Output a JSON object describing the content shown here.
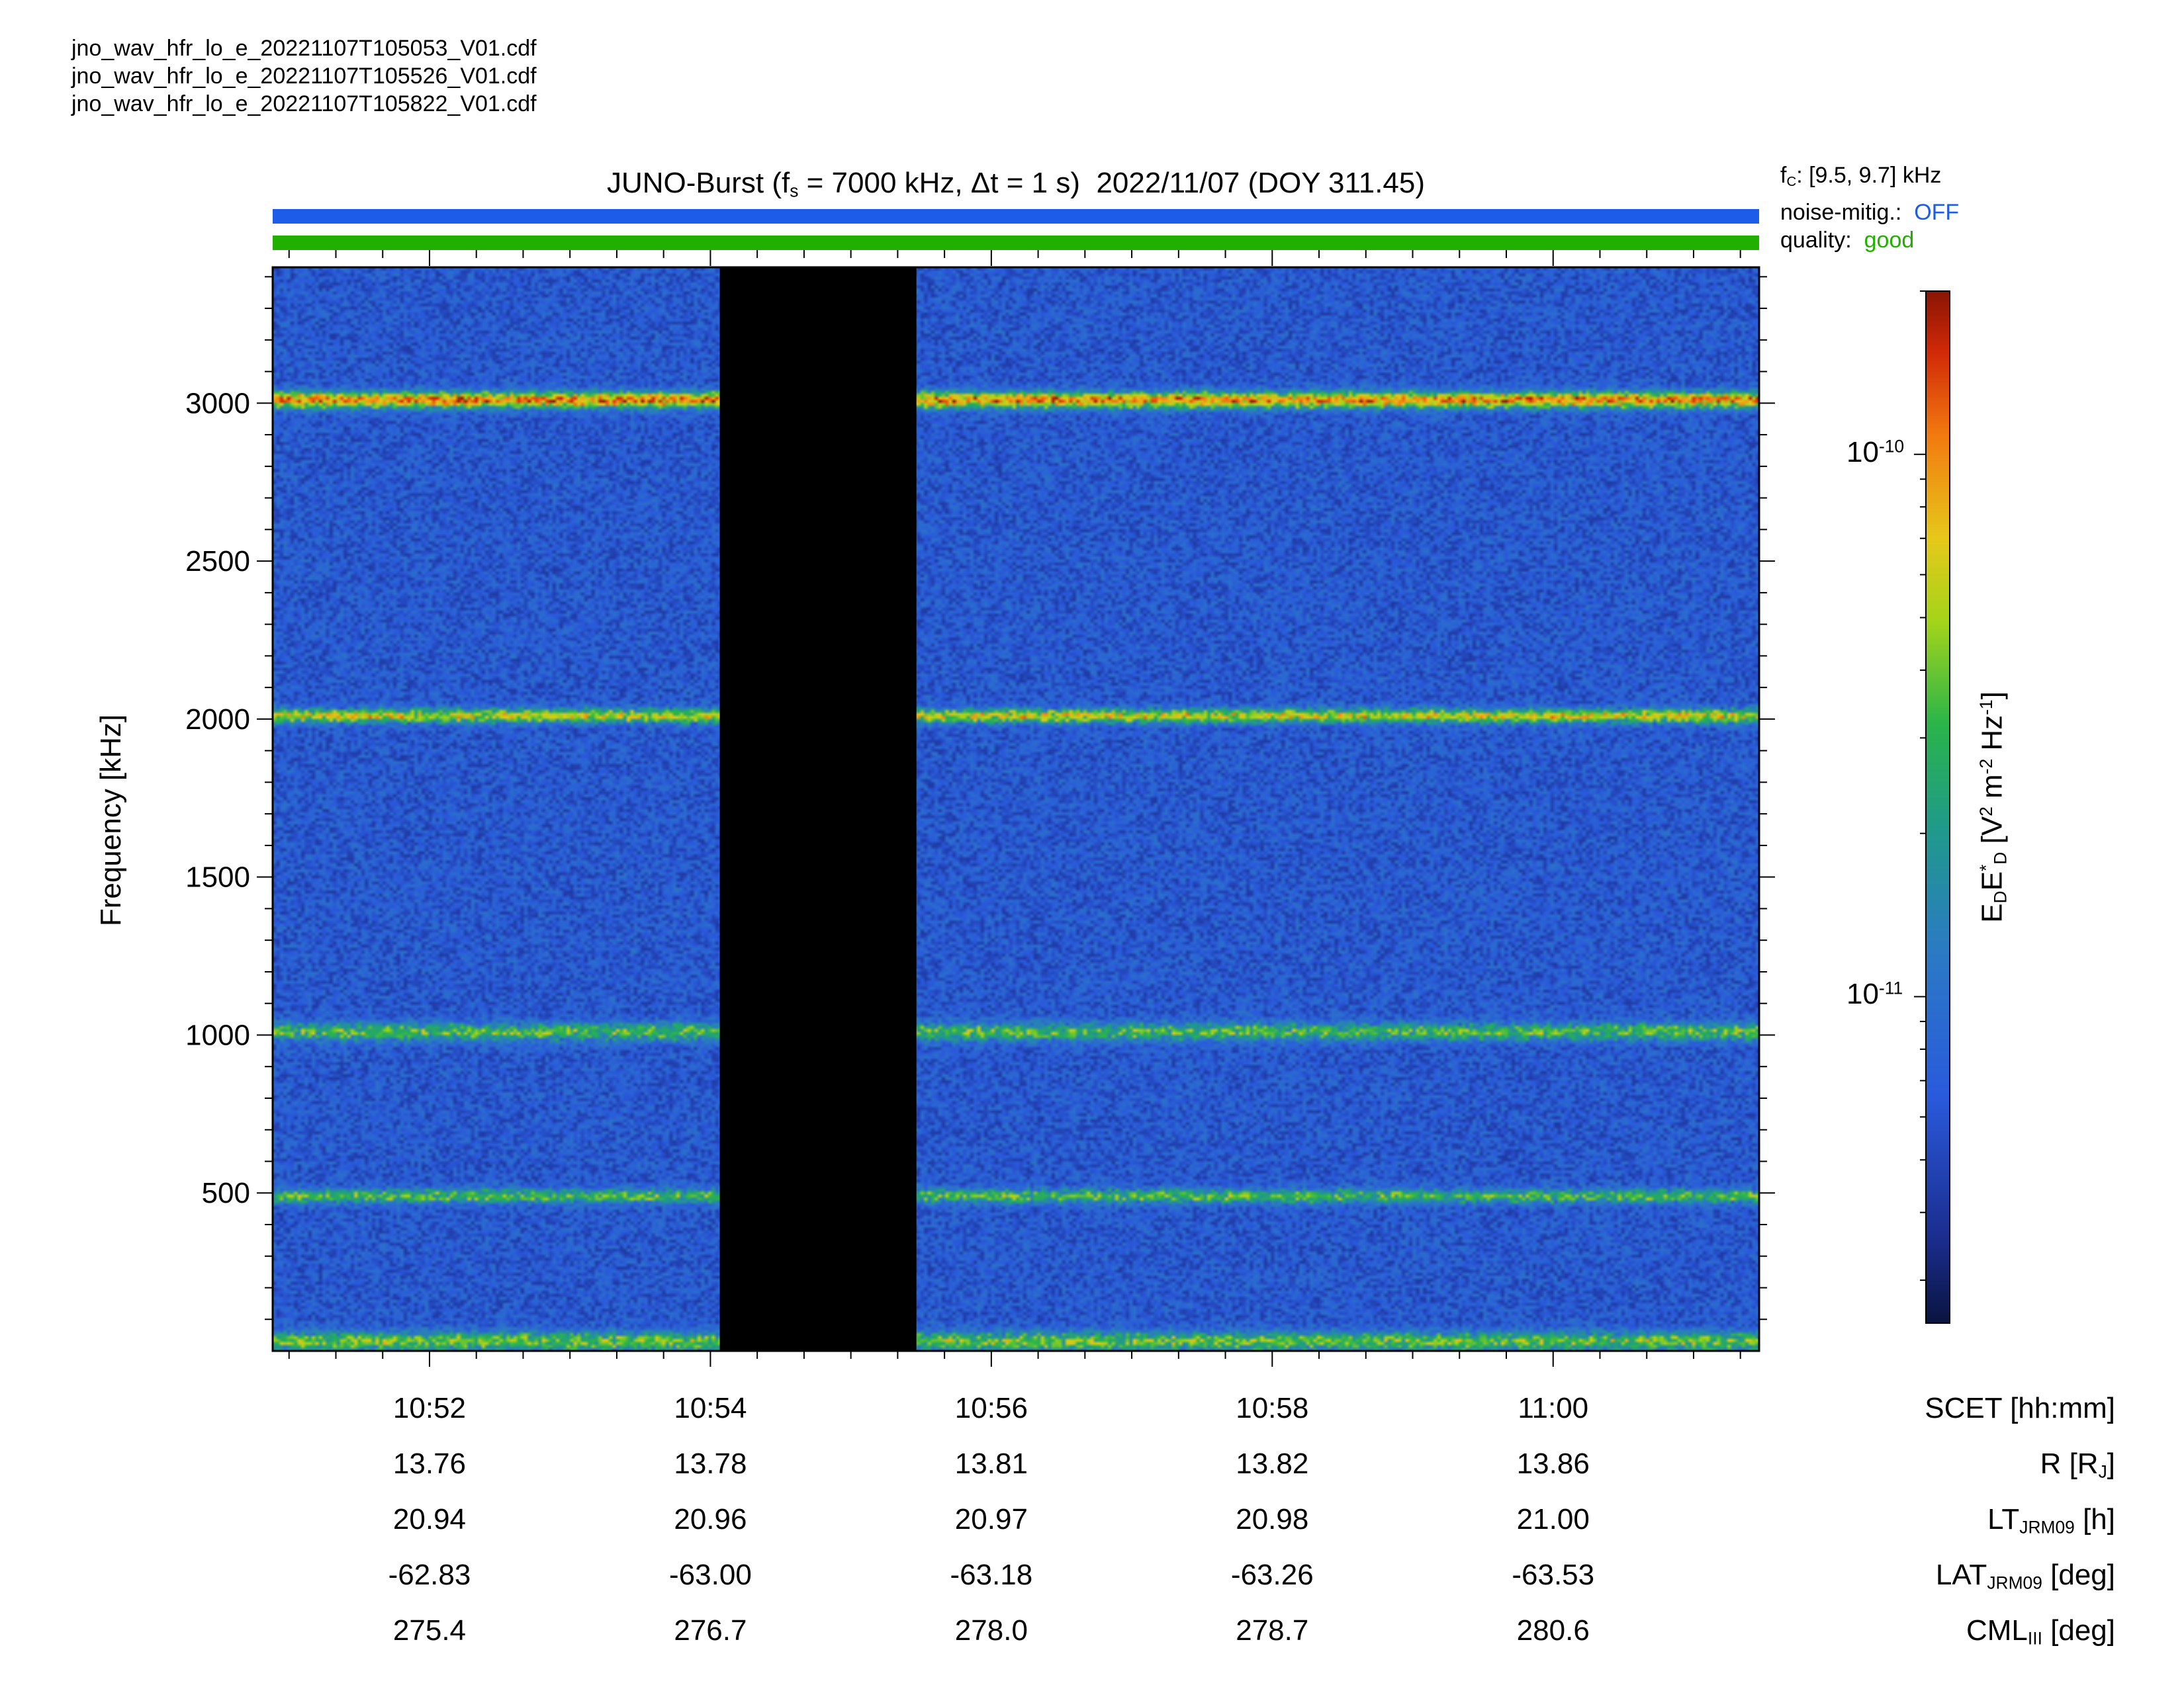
{
  "source_files": [
    "jno_wav_hfr_lo_e_20221107T105053_V01.cdf",
    "jno_wav_hfr_lo_e_20221107T105526_V01.cdf",
    "jno_wav_hfr_lo_e_20221107T105822_V01.cdf"
  ],
  "header": {
    "title": "JUNO-Burst (fs = 7000 kHz, Δt = 1 s)  2022/11/07 (DOY 311.45)",
    "fc_label": "fC: [9.5, 9.7] kHz",
    "noise_label": "noise-mitig.:",
    "noise_value": "OFF",
    "quality_label": "quality:",
    "quality_value": "good"
  },
  "colors": {
    "noise_bar": "#1d5ce8",
    "quality_bar": "#22b000",
    "gap": "#000000"
  },
  "chart_data": {
    "type": "heatmap",
    "title": "JUNO-Burst (fs = 7000 kHz, Δt = 1 s)  2022/11/07 (DOY 311.45)",
    "ylabel": "Frequency [kHz]",
    "xlabel": "SCET [hh:mm]",
    "x_start": "10:50:53",
    "x_end": "11:01:28",
    "x_ticks": [
      "10:52",
      "10:54",
      "10:56",
      "10:58",
      "11:00"
    ],
    "ylim": [
      0,
      3430
    ],
    "y_ticks": [
      500,
      1000,
      1500,
      2000,
      2500,
      3000
    ],
    "data_gap": [
      "10:54:04",
      "10:55:28"
    ],
    "emission_lines_khz": [
      30,
      490,
      1010,
      2010,
      3010
    ],
    "colorbar": {
      "label": "EDE*D [V2 m-2 Hz-1]",
      "scale": "log",
      "range": [
        2.5e-12,
        2e-10
      ],
      "ticks": [
        "10-10",
        "10-11"
      ]
    },
    "ephemeris_rows": [
      {
        "label": "SCET [hh:mm]",
        "values": [
          "10:52",
          "10:54",
          "10:56",
          "10:58",
          "11:00"
        ]
      },
      {
        "label": "R [RJ]",
        "values": [
          "13.76",
          "13.78",
          "13.81",
          "13.82",
          "13.86"
        ]
      },
      {
        "label": "LTJRM09 [h]",
        "values": [
          "20.94",
          "20.96",
          "20.97",
          "20.98",
          "21.00"
        ]
      },
      {
        "label": "LATJRM09 [deg]",
        "values": [
          "-62.83",
          "-63.00",
          "-63.18",
          "-63.26",
          "-63.53"
        ]
      },
      {
        "label": "CMLIII [deg]",
        "values": [
          "275.4",
          "276.7",
          "278.0",
          "278.7",
          "280.6"
        ]
      }
    ]
  }
}
